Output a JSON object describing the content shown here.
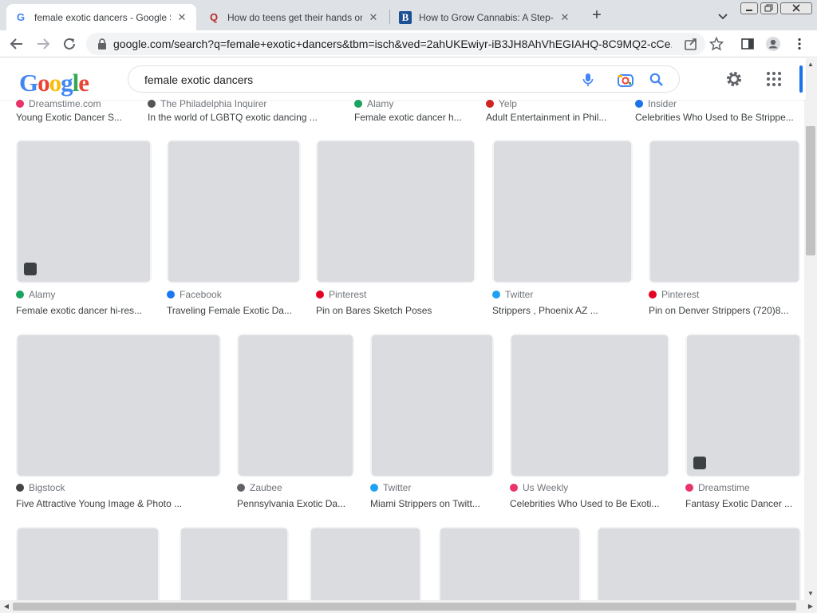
{
  "browser": {
    "tabs": [
      {
        "title": "female exotic dancers - Google S",
        "icon": "google-g-icon",
        "active": true
      },
      {
        "title": "How do teens get their hands on",
        "icon": "quora-icon",
        "active": false
      },
      {
        "title": "How to Grow Cannabis: A Step-B",
        "icon": "bing-b-icon",
        "active": false
      }
    ],
    "url": "google.com/search?q=female+exotic+dancers&tbm=isch&ved=2ahUKEwiyr-iB3JH8AhVhEGIAHQ-8C9MQ2-cCe..."
  },
  "search": {
    "logo_text": "Google",
    "query": "female exotic dancers"
  },
  "rows": [
    [
      {
        "source": "Dreamstime.com",
        "title": "Young Exotic Dancer S...",
        "icon_color": "#e8336b"
      },
      {
        "source": "The Philadelphia Inquirer",
        "title": "In the world of LGBTQ exotic dancing ...",
        "icon_color": "#555555"
      },
      {
        "source": "Alamy",
        "title": "Female exotic dancer h...",
        "icon_color": "#1aa260"
      },
      {
        "source": "Yelp",
        "title": "Adult Entertainment in Phil...",
        "icon_color": "#d32323"
      },
      {
        "source": "Insider",
        "title": "Celebrities Who Used to Be Strippe...",
        "icon_color": "#1a73e8"
      }
    ],
    [
      {
        "source": "Alamy",
        "title": "Female exotic dancer hi-res...",
        "icon_color": "#1aa260"
      },
      {
        "source": "Facebook",
        "title": "Traveling Female Exotic Da...",
        "icon_color": "#1877f2"
      },
      {
        "source": "Pinterest",
        "title": "Pin on Bares Sketch Poses",
        "icon_color": "#e60023"
      },
      {
        "source": "Twitter",
        "title": "Strippers , Phoenix AZ ...",
        "icon_color": "#1da1f2"
      },
      {
        "source": "Pinterest",
        "title": "Pin on Denver Strippers (720)8...",
        "icon_color": "#e60023"
      }
    ],
    [
      {
        "source": "Bigstock",
        "title": "Five Attractive Young Image & Photo ...",
        "icon_color": "#444444"
      },
      {
        "source": "Zaubee",
        "title": "Pennsylvania Exotic Da...",
        "icon_color": "#5f6368"
      },
      {
        "source": "Twitter",
        "title": "Miami Strippers on Twitt...",
        "icon_color": "#1da1f2"
      },
      {
        "source": "Us Weekly",
        "title": "Celebrities Who Used to Be Exoti...",
        "icon_color": "#e8336b"
      },
      {
        "source": "Dreamstime",
        "title": "Fantasy Exotic Dancer ...",
        "icon_color": "#e8336b"
      }
    ],
    [
      {
        "source": "",
        "title": ""
      },
      {
        "source": "",
        "title": ""
      },
      {
        "source": "",
        "title": ""
      },
      {
        "source": "",
        "title": ""
      },
      {
        "source": "",
        "title": ""
      }
    ]
  ],
  "colors": {
    "google_blue": "#4285f4",
    "google_red": "#ea4335",
    "google_yellow": "#fbbc05",
    "google_green": "#34a853",
    "accent": "#1a73e8"
  }
}
